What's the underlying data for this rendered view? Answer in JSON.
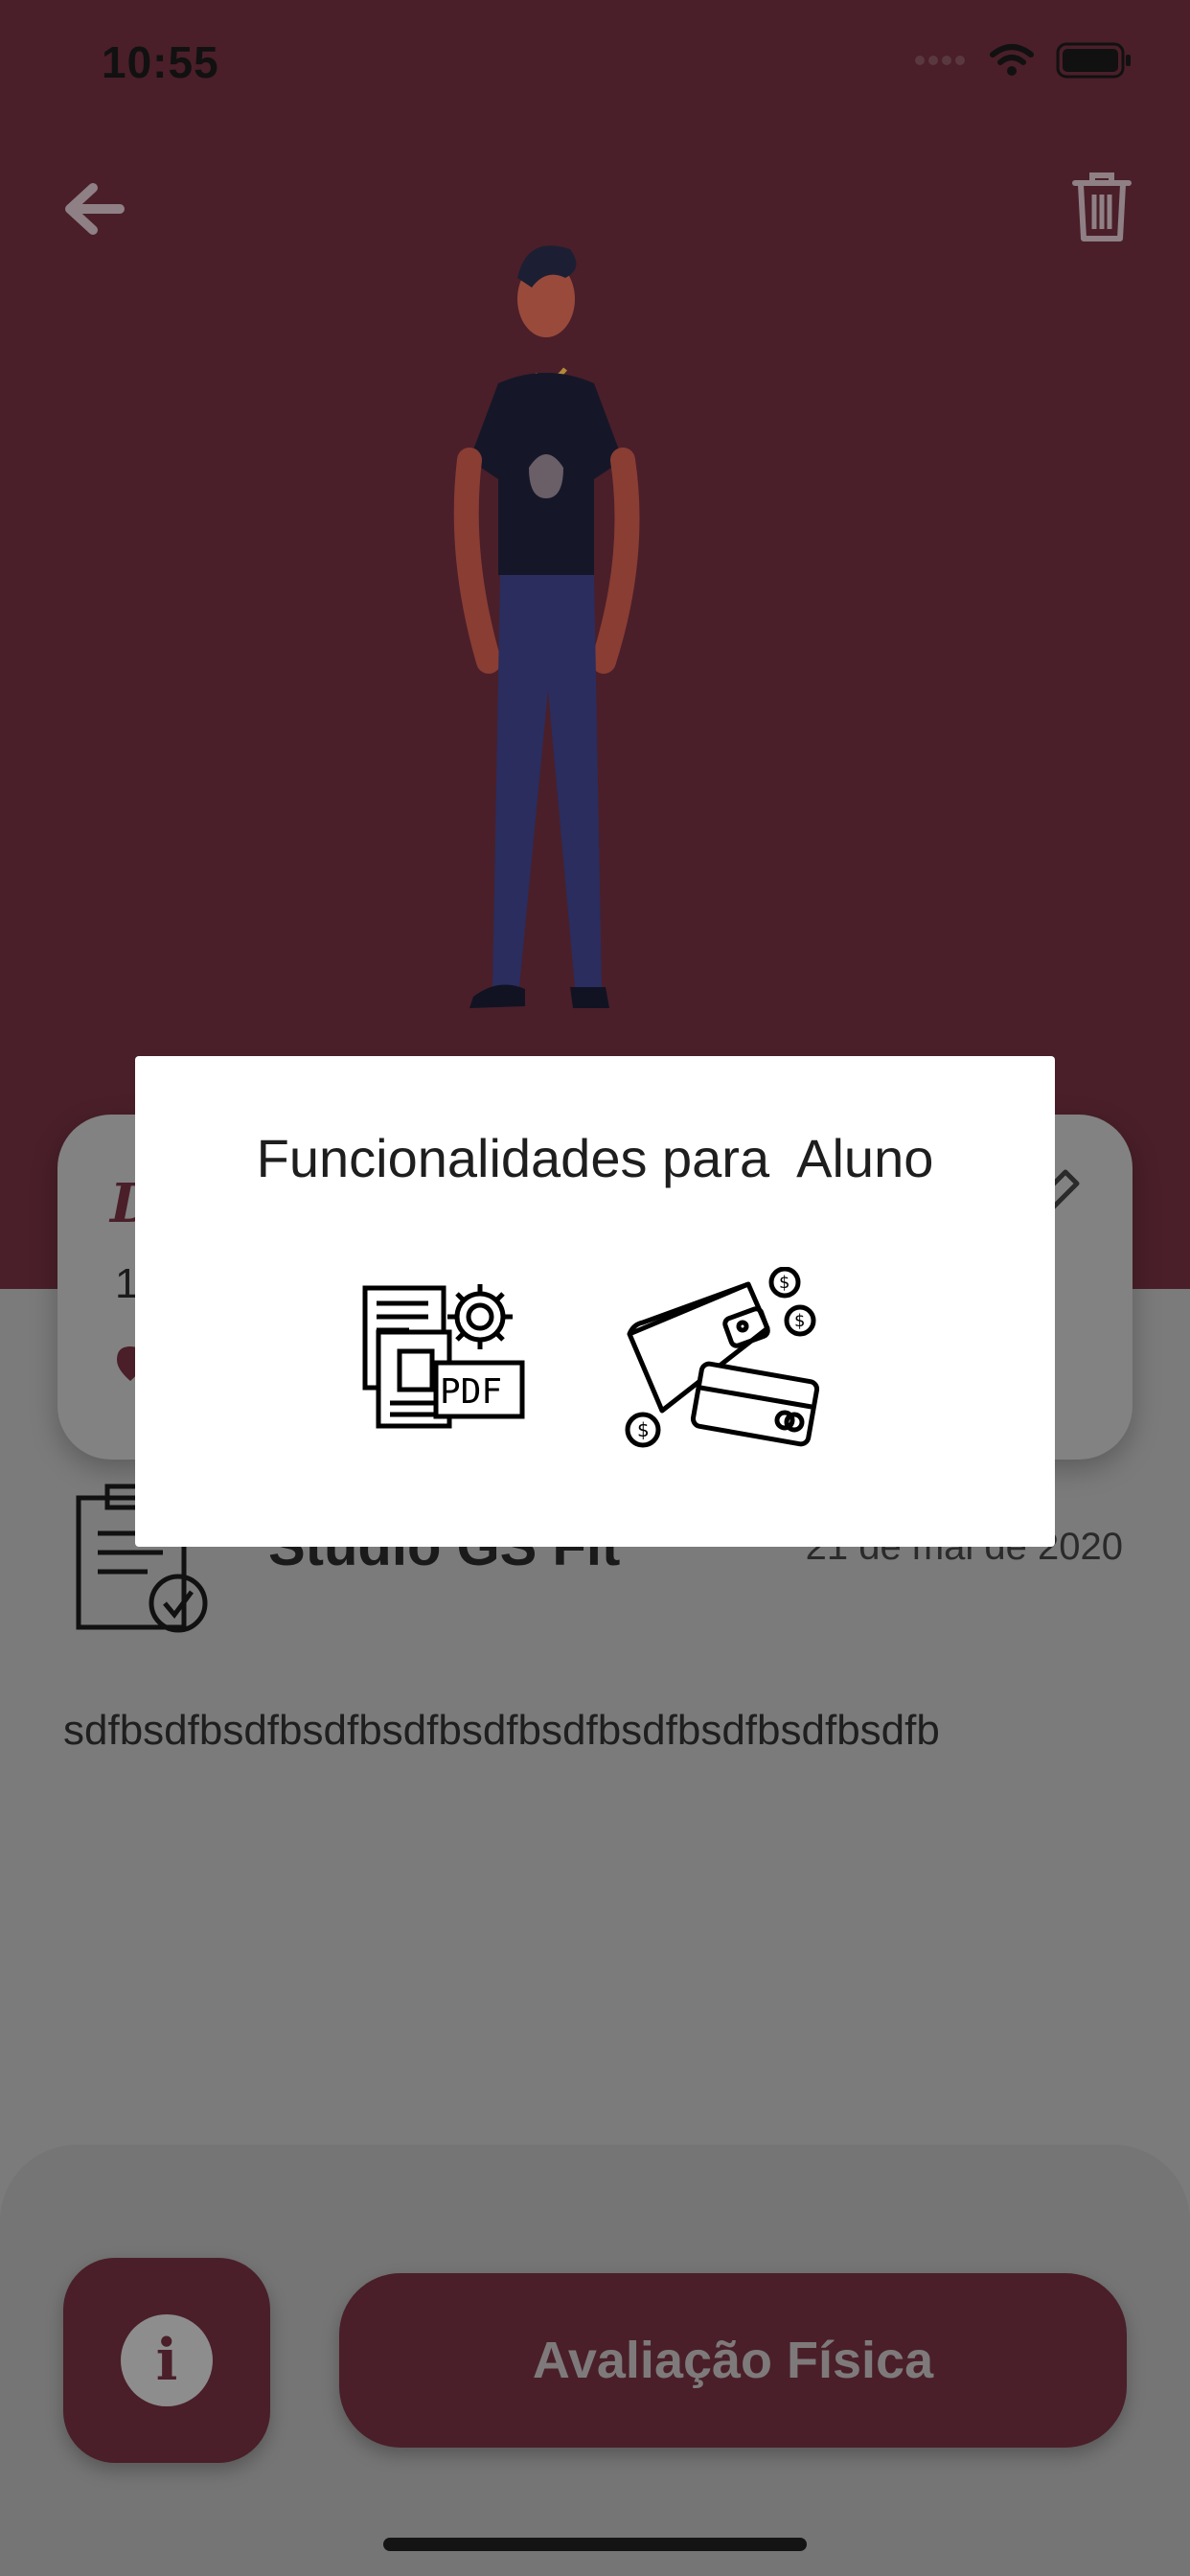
{
  "status_bar": {
    "time": "10:55"
  },
  "header": {
    "back_icon": "arrow-left-icon",
    "trash_icon": "trash-icon"
  },
  "card": {
    "letter": "D",
    "number": "1"
  },
  "studio": {
    "name": "Studio GS  Fit",
    "date": "21 de mai de 2020"
  },
  "description": "sdfbsdfbsdfbsdfbsdfbsdfbsdfbsdfbsdfbsdfbsdfb",
  "modal": {
    "title": "Funcionalidades para  Aluno",
    "options": [
      {
        "icon": "pdf-settings-icon"
      },
      {
        "icon": "wallet-payment-icon"
      }
    ]
  },
  "bottom": {
    "info_icon": "i",
    "eval_label": "Avaliação Física"
  },
  "colors": {
    "primary": "#4a1f29",
    "overlay": "#7b7b7b",
    "modal_bg": "#ffffff"
  }
}
